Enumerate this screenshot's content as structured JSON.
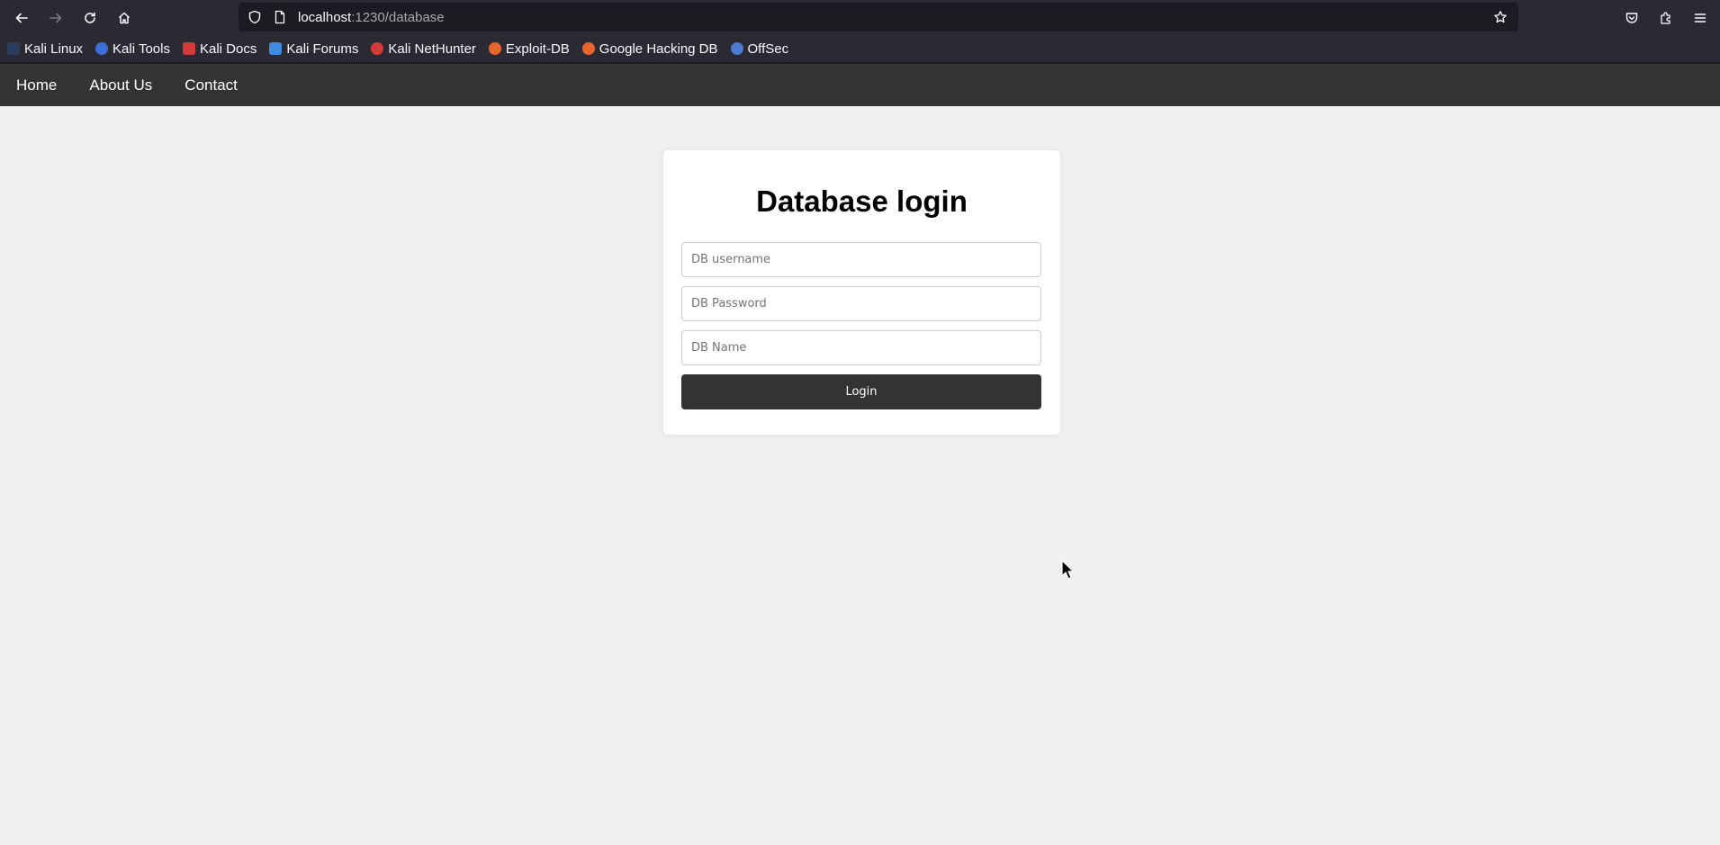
{
  "browser": {
    "url_host": "localhost",
    "url_path": ":1230/database",
    "bookmarks": [
      {
        "label": "Kali Linux",
        "icon": "kali-dragon-icon",
        "color": "#367bf0"
      },
      {
        "label": "Kali Tools",
        "icon": "kali-tools-icon",
        "color": "#3b6fd8"
      },
      {
        "label": "Kali Docs",
        "icon": "kali-docs-icon",
        "color": "#d33b3b"
      },
      {
        "label": "Kali Forums",
        "icon": "kali-forums-icon",
        "color": "#3f8be0"
      },
      {
        "label": "Kali NetHunter",
        "icon": "nethunter-icon",
        "color": "#d33b3b"
      },
      {
        "label": "Exploit-DB",
        "icon": "exploit-db-icon",
        "color": "#e8652b"
      },
      {
        "label": "Google Hacking DB",
        "icon": "ghdb-icon",
        "color": "#e8652b"
      },
      {
        "label": "OffSec",
        "icon": "offsec-icon",
        "color": "#4a7bd0"
      }
    ]
  },
  "nav": {
    "home": "Home",
    "about": "About Us",
    "contact": "Contact"
  },
  "login": {
    "title": "Database login",
    "username_placeholder": "DB username",
    "password_placeholder": "DB Password",
    "dbname_placeholder": "DB Name",
    "submit_label": "Login"
  },
  "colors": {
    "nav_bg": "#333333",
    "page_bg": "#f0f0f0",
    "button_bg": "#333333"
  }
}
